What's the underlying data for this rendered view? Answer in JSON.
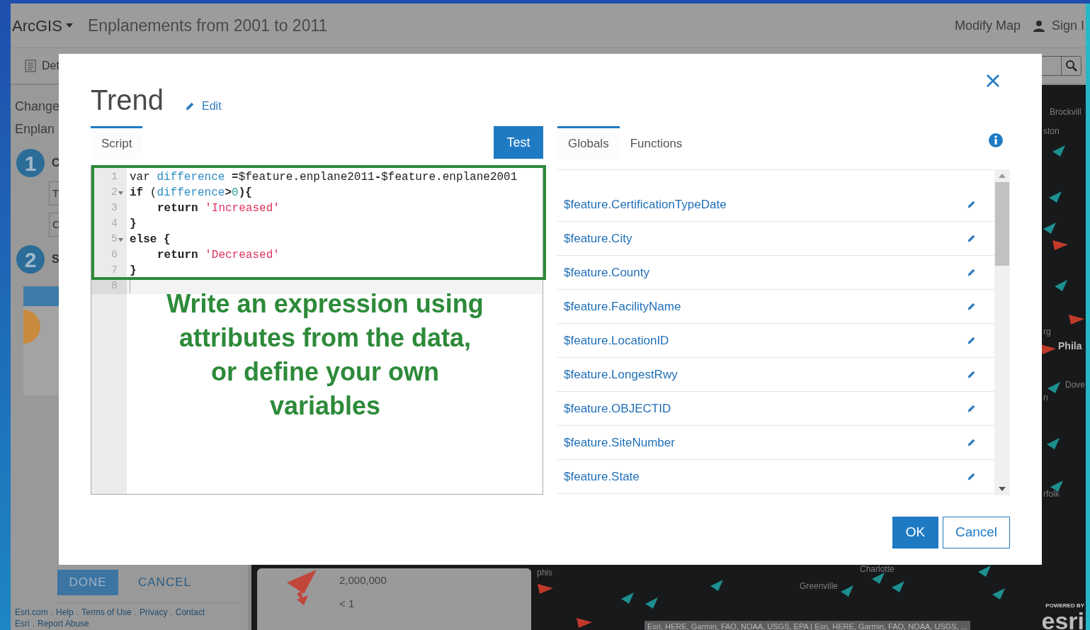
{
  "header": {
    "app_name": "ArcGIS",
    "title": "Enplanements from 2001 to 2011",
    "modify": "Modify Map",
    "sign_in": "Sign I"
  },
  "toolbar": {
    "details": "Det"
  },
  "side_panel": {
    "lines": [
      "Change",
      "Enplan"
    ],
    "steps": [
      {
        "number": "1",
        "label": "C"
      },
      {
        "number": "2",
        "label": "S"
      }
    ],
    "fields": [
      "T",
      "C"
    ],
    "done": "DONE",
    "cancel": "CANCEL",
    "footer_separator": ".",
    "footer_rows": [
      [
        "Esri.com",
        "Help",
        "Terms of Use",
        "Privacy",
        "Contact"
      ],
      [
        "Esri",
        "Report Abuse"
      ]
    ]
  },
  "map": {
    "labels": [
      "Brockvill",
      "ston",
      "rg",
      "Phila",
      "Dove",
      "n",
      "rfolk",
      "phis",
      "Charlotte",
      "Greenville"
    ],
    "legend": [
      "2,000,000",
      "< 1"
    ],
    "attribution": "Esri, HERE, Garmin, FAO, NOAA, USGS, EPA | Esri, HERE, Garmin, FAO, NOAA, USGS, ...",
    "powered_by": "POWERED BY",
    "brand": "esri"
  },
  "dialog": {
    "title": "Trend",
    "edit": "Edit",
    "script_tabs": [
      {
        "label": "Script",
        "selected": true
      }
    ],
    "test": "Test",
    "code_lines": [
      {
        "number": "1",
        "fold": false,
        "active": false,
        "indent": false,
        "tokens": [
          {
            "kind": "plain",
            "text": "var "
          },
          {
            "kind": "variable",
            "text": "difference"
          },
          {
            "kind": "keyword",
            "text": " ="
          },
          {
            "kind": "plain",
            "text": "$feature.enplane2011"
          },
          {
            "kind": "keyword",
            "text": "-"
          },
          {
            "kind": "plain",
            "text": "$feature.enplane2001"
          }
        ]
      },
      {
        "number": "2",
        "fold": true,
        "active": false,
        "indent": false,
        "tokens": [
          {
            "kind": "keyword",
            "text": "if"
          },
          {
            "kind": "plain",
            "text": " ("
          },
          {
            "kind": "variable",
            "text": "difference"
          },
          {
            "kind": "keyword",
            "text": ">"
          },
          {
            "kind": "number",
            "text": "0"
          },
          {
            "kind": "keyword",
            "text": "){"
          }
        ]
      },
      {
        "number": "3",
        "fold": false,
        "active": false,
        "indent": true,
        "tokens": [
          {
            "kind": "keyword",
            "text": "return"
          },
          {
            "kind": "string",
            "text": " 'Increased'"
          }
        ]
      },
      {
        "number": "4",
        "fold": false,
        "active": false,
        "indent": false,
        "tokens": [
          {
            "kind": "keyword",
            "text": "}"
          }
        ]
      },
      {
        "number": "5",
        "fold": true,
        "active": false,
        "indent": false,
        "tokens": [
          {
            "kind": "keyword",
            "text": "else {"
          }
        ]
      },
      {
        "number": "6",
        "fold": false,
        "active": false,
        "indent": true,
        "tokens": [
          {
            "kind": "keyword",
            "text": "return"
          },
          {
            "kind": "string",
            "text": " 'Decreased'"
          }
        ]
      },
      {
        "number": "7",
        "fold": false,
        "active": false,
        "indent": false,
        "tokens": [
          {
            "kind": "keyword",
            "text": "}"
          }
        ]
      },
      {
        "number": "8",
        "fold": false,
        "active": true
      }
    ],
    "annotation": "Write an expression using attributes from the data, or define your own variables",
    "reference_tabs": [
      {
        "label": "Globals",
        "selected": true
      },
      {
        "label": "Functions",
        "selected": false
      }
    ],
    "globals": [
      "$feature.CertificationTypeDate",
      "$feature.City",
      "$feature.County",
      "$feature.FacilityName",
      "$feature.LocationID",
      "$feature.LongestRwy",
      "$feature.OBJECTID",
      "$feature.SiteNumber",
      "$feature.State"
    ],
    "ok": "OK",
    "cancel": "Cancel"
  }
}
